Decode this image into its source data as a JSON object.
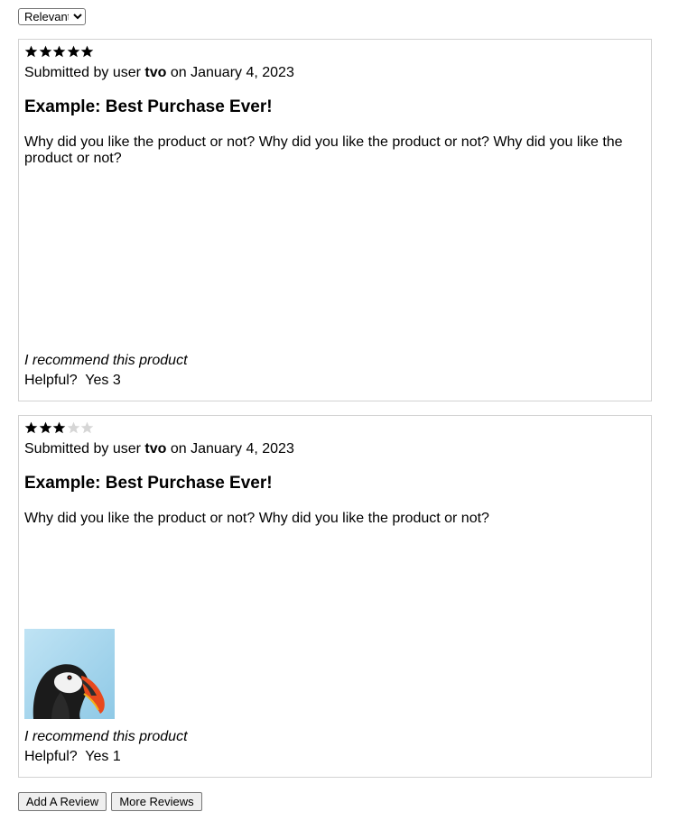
{
  "sort": {
    "options": [
      "Relevant"
    ],
    "selected": "Relevant"
  },
  "reviews": [
    {
      "rating": 5,
      "submitted_prefix": "Submitted by user ",
      "user": "tvo",
      "date_text": " on January 4, 2023",
      "title": "Example: Best Purchase Ever!",
      "body": "Why did you like the product or not? Why did you like the product or not? Why did you like the product or not?",
      "recommend": "I recommend this product",
      "helpful_label": "Helpful?  Yes",
      "helpful_count": "3"
    },
    {
      "rating": 3,
      "submitted_prefix": "Submitted by user ",
      "user": "tvo",
      "date_text": " on January 4, 2023",
      "title": "Example: Best Purchase Ever!",
      "body": "Why did you like the product or not? Why did you like the product or not?",
      "photo_icon": "puffin-photo",
      "recommend": "I recommend this product",
      "helpful_label": "Helpful?  Yes",
      "helpful_count": "1"
    }
  ],
  "actions": {
    "add_review": "Add A Review",
    "more_reviews": "More Reviews"
  },
  "colors": {
    "star_filled": "#000000",
    "star_empty": "#d6d6d6",
    "border": "#d2d2d2"
  }
}
